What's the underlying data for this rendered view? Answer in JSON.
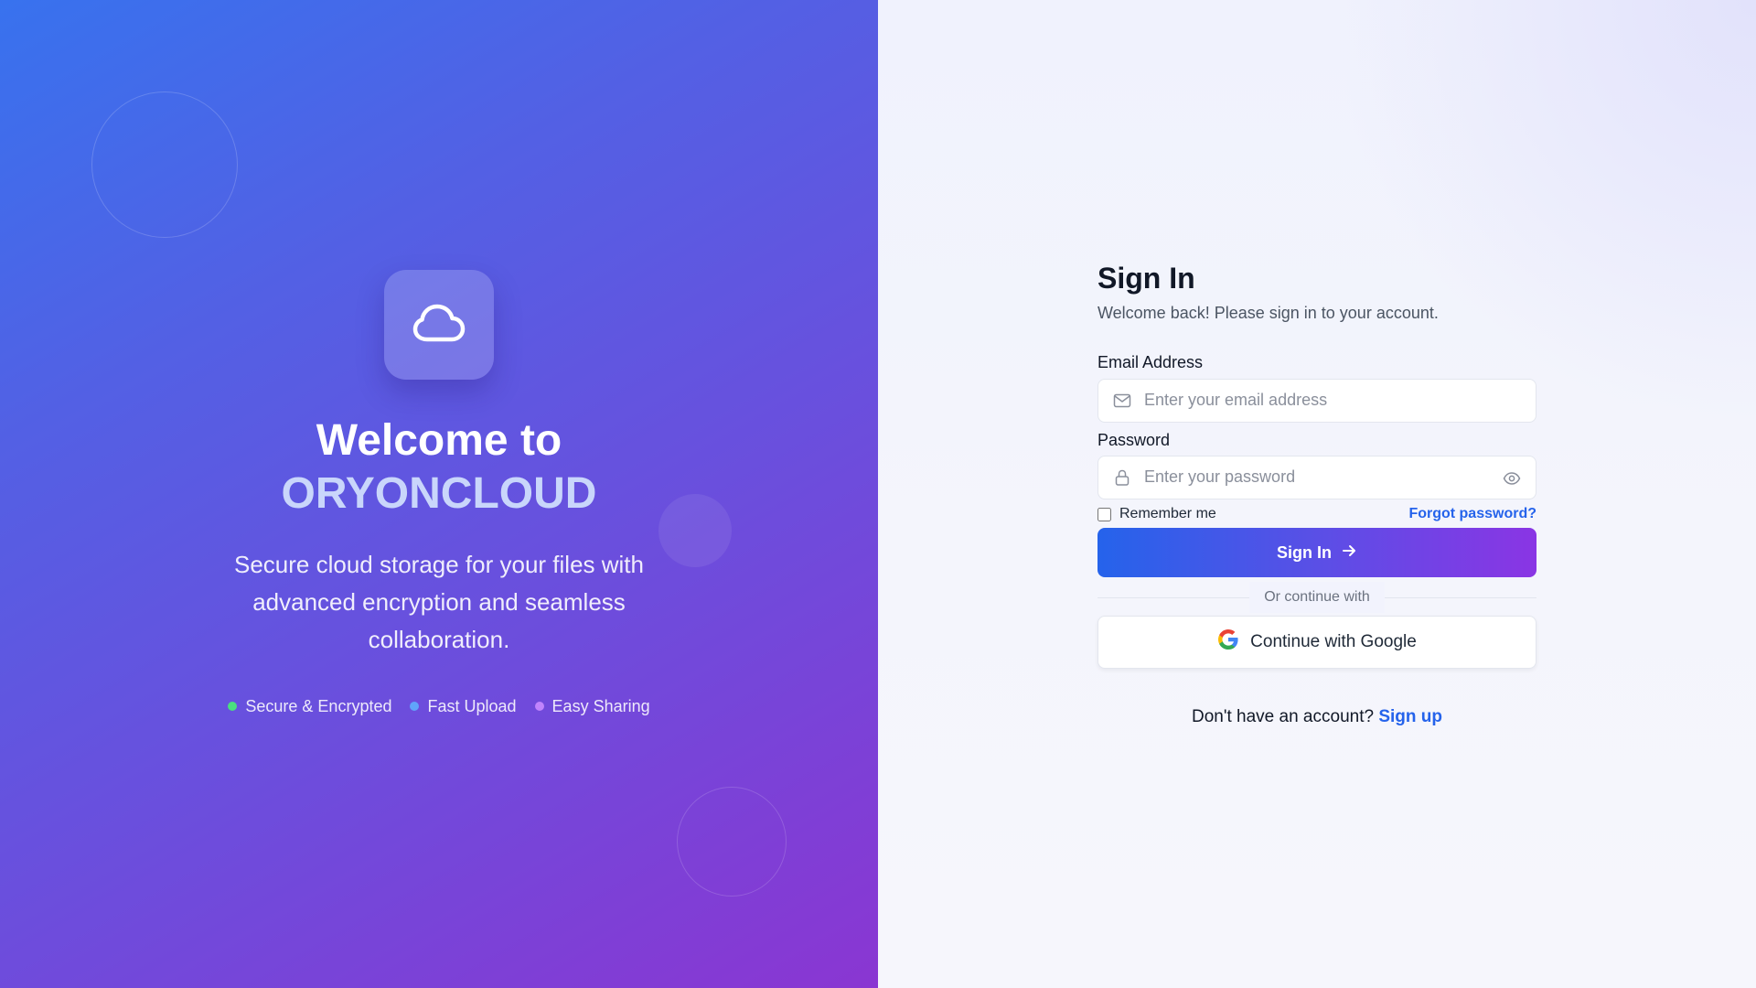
{
  "hero": {
    "logo_icon": "cloud-icon",
    "title_line1": "Welcome to",
    "title_line2": "ORYONCLOUD",
    "description": "Secure cloud storage for your files with advanced encryption and seamless collaboration.",
    "features": [
      {
        "label": "Secure & Encrypted",
        "dot_color": "#4ade80"
      },
      {
        "label": "Fast Upload",
        "dot_color": "#60a5fa"
      },
      {
        "label": "Easy Sharing",
        "dot_color": "#c084fc"
      }
    ]
  },
  "form": {
    "title": "Sign In",
    "subtitle": "Welcome back! Please sign in to your account.",
    "email": {
      "label": "Email Address",
      "placeholder": "Enter your email address",
      "icon": "mail-icon"
    },
    "password": {
      "label": "Password",
      "placeholder": "Enter your password",
      "icon": "lock-icon",
      "toggle_icon": "eye-icon"
    },
    "remember_label": "Remember me",
    "forgot_label": "Forgot password?",
    "signin_button": "Sign In",
    "divider_text": "Or continue with",
    "google_button": "Continue with Google",
    "signup_prompt": "Don't have an account?",
    "signup_link": "Sign up"
  },
  "colors": {
    "accent_blue": "#2563eb",
    "accent_purple": "#8a35e4",
    "hero_start": "#3872ee",
    "hero_end": "#8a36d2"
  }
}
